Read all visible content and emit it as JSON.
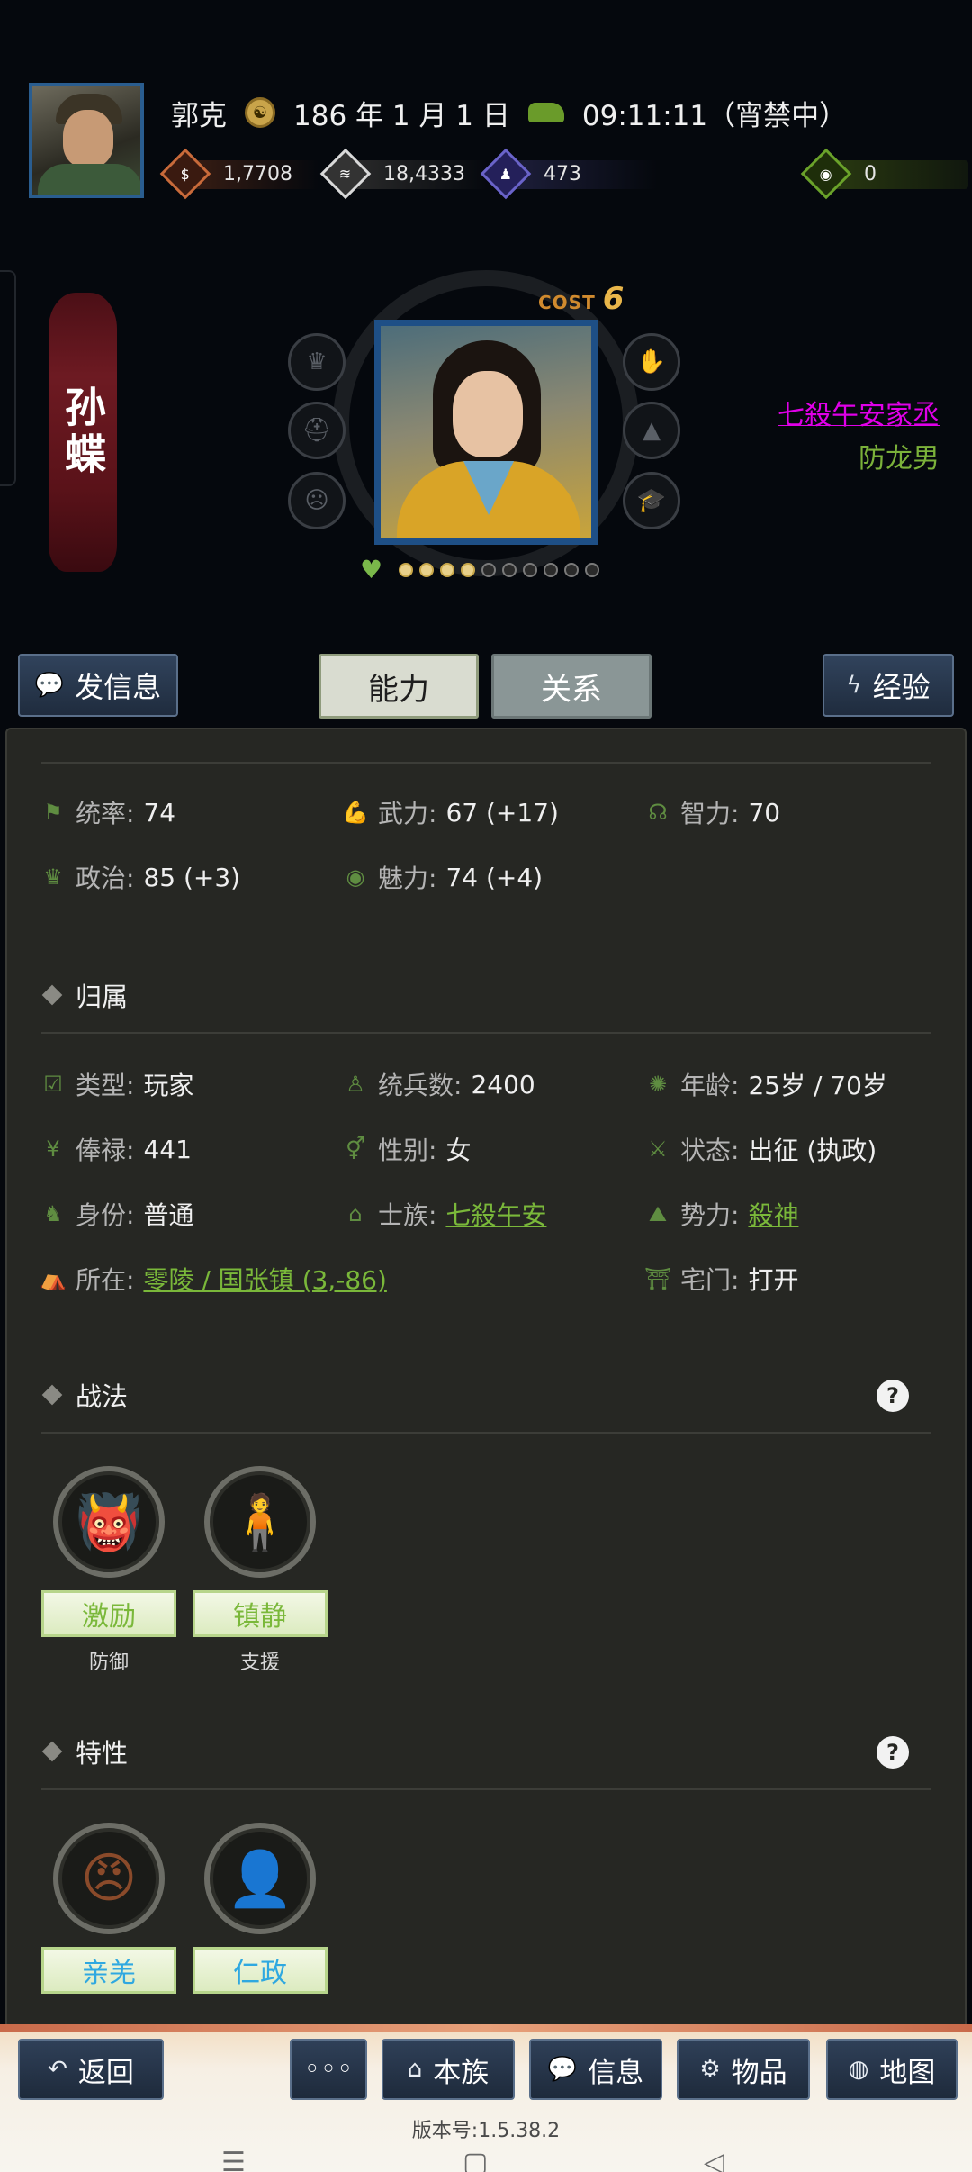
{
  "top": {
    "player_name": "郭克",
    "date": "186 年 1 月 1 日",
    "time": "09:11:11（宵禁中）",
    "resources": [
      {
        "icon": "money-icon",
        "value": "1,7708",
        "color": "#c86a3a"
      },
      {
        "icon": "grain-icon",
        "value": "18,4333",
        "color": "#d9d9d9"
      },
      {
        "icon": "soldier-icon",
        "value": "473",
        "color": "#6a63c9"
      },
      {
        "icon": "bag-icon",
        "value": "0",
        "color": "#6aa22a"
      }
    ]
  },
  "hero": {
    "name": "孙蝶",
    "cost_label": "COST",
    "cost_value": "6",
    "title_primary": "七殺午安家丞",
    "title_secondary": "防龙男",
    "stars_filled": 4,
    "stars_total": 10,
    "left_icons": [
      "crown-icon",
      "helmet-icon",
      "mask-icon"
    ],
    "right_icons": [
      "hand-icon",
      "hat-icon",
      "mortarboard-icon"
    ]
  },
  "actions": {
    "message_label": "发信息",
    "tab_ability": "能力",
    "tab_relation": "关系",
    "exp_label": "经验"
  },
  "stats": [
    [
      {
        "icon": "flag-icon",
        "key": "统率:",
        "value": "74"
      },
      {
        "icon": "arm-icon",
        "key": "武力:",
        "value": "67 (+17)"
      },
      {
        "icon": "brain-icon",
        "key": "智力:",
        "value": "70"
      }
    ],
    [
      {
        "icon": "politics-icon",
        "key": "政治:",
        "value": "85 (+3)"
      },
      {
        "icon": "eye-icon",
        "key": "魅力:",
        "value": "74 (+4)"
      }
    ]
  ],
  "belong": {
    "title": "归属",
    "rows": [
      [
        {
          "icon": "type-icon",
          "key": "类型:",
          "value": "玩家"
        },
        {
          "icon": "troops-icon",
          "key": "统兵数:",
          "value": "2400"
        },
        {
          "icon": "age-icon",
          "key": "年龄:",
          "value": "25岁 / 70岁"
        }
      ],
      [
        {
          "icon": "salary-icon",
          "key": "俸禄:",
          "value": "441"
        },
        {
          "icon": "gender-icon",
          "key": "性别:",
          "value": "女"
        },
        {
          "icon": "status-icon",
          "key": "状态:",
          "value": "出征 (执政)"
        }
      ],
      [
        {
          "icon": "identity-icon",
          "key": "身份:",
          "value": "普通"
        },
        {
          "icon": "clan-icon",
          "key": "士族:",
          "value": "七殺午安",
          "link": true
        },
        {
          "icon": "faction-icon",
          "key": "势力:",
          "value": "殺神",
          "link": true
        }
      ],
      [
        {
          "icon": "location-icon",
          "key": "所在:",
          "value": "零陵 / 国张镇 (3,-86)",
          "link": true
        },
        {
          "icon": "gate-icon",
          "key": "宅门:",
          "value": "打开"
        }
      ]
    ]
  },
  "tactics": {
    "title": "战法",
    "help": "?",
    "items": [
      {
        "name": "激励",
        "sub": "防御",
        "icon": "inspire-icon",
        "color": "#7ab83a",
        "glyph": "👹"
      },
      {
        "name": "镇静",
        "sub": "支援",
        "icon": "calm-icon",
        "color": "#7ab83a",
        "glyph": "🧍"
      }
    ]
  },
  "traits": {
    "title": "特性",
    "help": "?",
    "items": [
      {
        "name": "亲羌",
        "icon": "qiang-mask-icon",
        "color": "#2fa8e0",
        "glyph": "😠"
      },
      {
        "name": "仁政",
        "icon": "laurel-head-icon",
        "color": "#2fa8e0",
        "glyph": "👤"
      }
    ]
  },
  "bottom_nav": {
    "back": "返回",
    "more": "◦◦◦",
    "clan": "本族",
    "info": "信息",
    "items": "物品",
    "map": "地图",
    "version": "版本号:1.5.38.2"
  }
}
